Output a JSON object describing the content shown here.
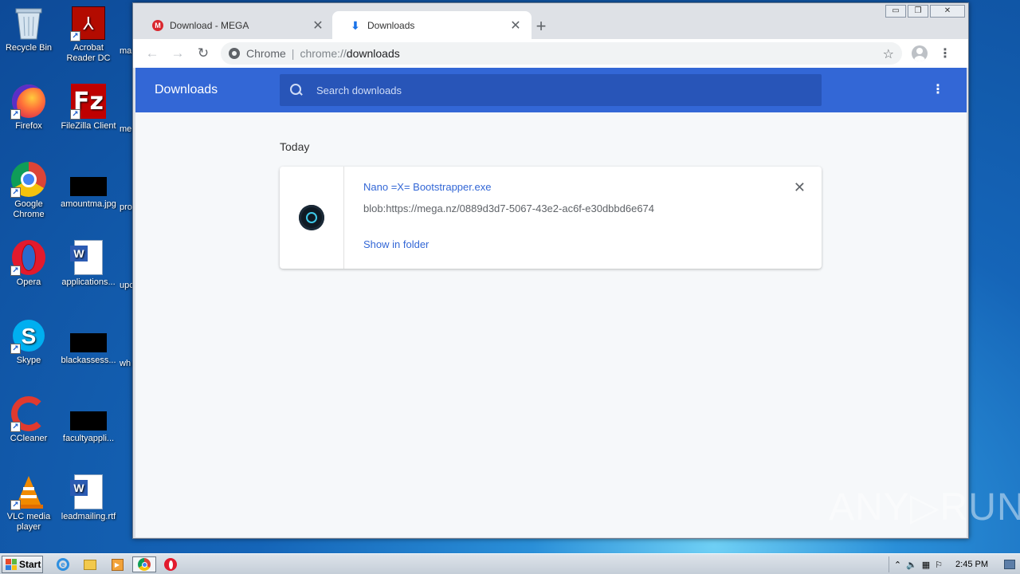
{
  "desktop": {
    "icons": [
      {
        "label": "Recycle Bin"
      },
      {
        "label": "Acrobat Reader DC"
      },
      {
        "label": "Firefox"
      },
      {
        "label": "FileZilla Client"
      },
      {
        "label": "Google Chrome"
      },
      {
        "label": "amountma.jpg"
      },
      {
        "label": "Opera"
      },
      {
        "label": "applications..."
      },
      {
        "label": "Skype"
      },
      {
        "label": "blackassess..."
      },
      {
        "label": "CCleaner"
      },
      {
        "label": "facultyappli..."
      },
      {
        "label": "VLC media player"
      },
      {
        "label": "leadmailing.rtf"
      }
    ],
    "partial_labels": [
      "ma",
      "me",
      "pro",
      "upc",
      "wh"
    ]
  },
  "browser": {
    "tabs": [
      {
        "title": "Download - MEGA",
        "icon": "mega-icon",
        "active": false
      },
      {
        "title": "Downloads",
        "icon": "download-icon",
        "active": true
      }
    ],
    "window_controls": {
      "minimize": "▭",
      "restore": "❐",
      "close": "✕"
    },
    "omnibox": {
      "scheme_label": "Chrome",
      "separator": "|",
      "url_prefix": "chrome://",
      "url_path": "downloads"
    }
  },
  "downloads_page": {
    "title": "Downloads",
    "search_placeholder": "Search downloads",
    "section_label": "Today",
    "items": [
      {
        "file_name": "Nano =X= Bootstrapper.exe",
        "url": "blob:https://mega.nz/0889d3d7-5067-43e2-ac6f-e30dbbd6e674",
        "action": "Show in folder"
      }
    ]
  },
  "watermark": "ANY▷RUN",
  "taskbar": {
    "start_label": "Start",
    "clock": "2:45 PM"
  }
}
